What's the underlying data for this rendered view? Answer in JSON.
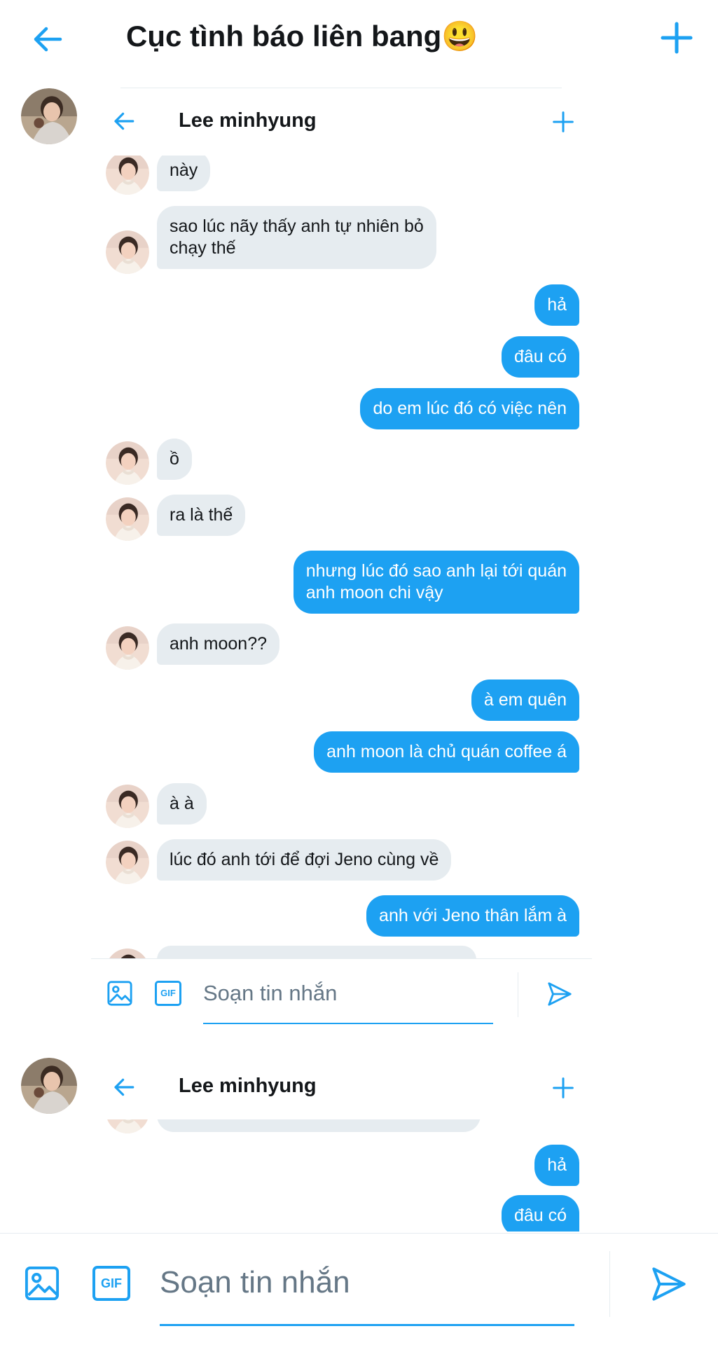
{
  "header": {
    "title": "Cục tình báo liên bang",
    "title_emoji": "😃"
  },
  "embed1": {
    "title": "Lee minhyung",
    "messages": [
      {
        "dir": "in",
        "text": "này"
      },
      {
        "dir": "in",
        "text": "sao lúc nãy thấy anh tự nhiên bỏ",
        "text2": "chạy thế"
      },
      {
        "dir": "out",
        "text": "hả"
      },
      {
        "dir": "out",
        "text": "đâu có"
      },
      {
        "dir": "out",
        "text": "do em lúc đó có việc nên"
      },
      {
        "dir": "in",
        "text": "ồ"
      },
      {
        "dir": "in",
        "text": "ra là thế"
      },
      {
        "dir": "out",
        "text": "nhưng lúc đó sao anh lại tới quán",
        "text2": "anh moon chi vậy"
      },
      {
        "dir": "in",
        "text": "anh moon??"
      },
      {
        "dir": "out",
        "text": "à em quên"
      },
      {
        "dir": "out",
        "text": "anh moon là chủ quán coffee á"
      },
      {
        "dir": "in",
        "text": "à à"
      },
      {
        "dir": "in",
        "text": "lúc đó anh tới để đợi Jeno cùng về"
      },
      {
        "dir": "out",
        "text": "anh với Jeno thân lắm à"
      }
    ],
    "compose": {
      "placeholder": "Soạn tin nhắn",
      "gif_label": "GIF"
    }
  },
  "embed2": {
    "title": "Lee minhyung",
    "messages": [
      {
        "dir": "out",
        "text": "hả"
      },
      {
        "dir": "out",
        "text": "đâu có"
      }
    ]
  },
  "compose": {
    "placeholder": "Soạn tin nhắn",
    "gif_label": "GIF"
  },
  "colors": {
    "accent": "#1da1f2",
    "incoming_bubble": "#e6ecf0",
    "text": "#14171a",
    "muted": "#657786"
  }
}
